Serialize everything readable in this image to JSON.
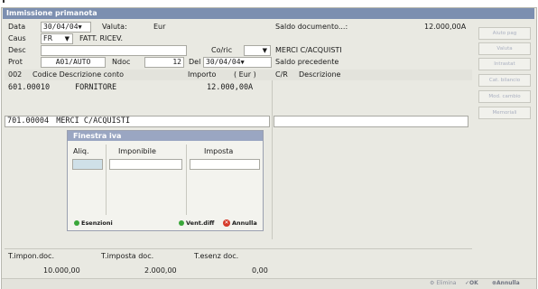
{
  "window": {
    "title": "Immissione primanota"
  },
  "header": {
    "data_label": "Data",
    "data_value": "30/04/04",
    "valuta_label": "Valuta:",
    "valuta_value": "Eur",
    "saldo_doc_label": "Saldo documento...:",
    "saldo_doc_value": "12.000,00A",
    "caus_label": "Caus",
    "caus_code": "FR",
    "caus_desc": "FATT. RICEV.",
    "desc_label": "Desc",
    "desc_value": "",
    "coric_label": "Co/ric",
    "coric_value": "",
    "coric_desc": "MERCI C/ACQUISTI",
    "prot_label": "Prot",
    "prot_value": "A01/AUTO",
    "ndoc_label": "Ndoc",
    "ndoc_value": "12",
    "del_label": "Del",
    "del_value": "30/04/04",
    "saldo_prec_label": "Saldo precedente"
  },
  "side_buttons": [
    "Aiuto pag",
    "Valuta",
    "Intrastat",
    "Cat. bilancio",
    "Mod. cambio",
    "Memoriali"
  ],
  "grid": {
    "col_seq": "002",
    "col_code": "Codice Descrizione conto",
    "col_amount": "Importo",
    "col_currency": "( Eur )",
    "col_cr": "C/R",
    "col_descr": "Descrizione",
    "rows": [
      {
        "code": "601.00010",
        "desc": "FORNITORE",
        "amount": "12.000,00A"
      },
      {
        "code": "701.00004",
        "desc": "MERCI C/ACQUISTI",
        "amount": ""
      }
    ]
  },
  "iva_dialog": {
    "title": "Finestra iva",
    "col_aliq": "Aliq.",
    "col_imponibile": "Imponibile",
    "col_imposta": "Imposta",
    "btn_esenzioni": "Esenzioni",
    "btn_ventdiff": "Vent.diff",
    "btn_annulla": "Annulla"
  },
  "totals": {
    "imponibile_label": "T.impon.doc.",
    "imposta_label": "T.imposta doc.",
    "esenz_label": "T.esenz doc.",
    "imponibile_value": "10.000,00",
    "imposta_value": "2.000,00",
    "esenz_value": "0,00"
  },
  "bottom_buttons": {
    "elimina": "Elimina",
    "ok": "OK",
    "annulla": "Annulla"
  },
  "colors": {
    "titlebar": "#7c8fb0",
    "dialog_title": "#9aa6c2",
    "green": "#3aa63a",
    "red": "#d63a2a"
  }
}
